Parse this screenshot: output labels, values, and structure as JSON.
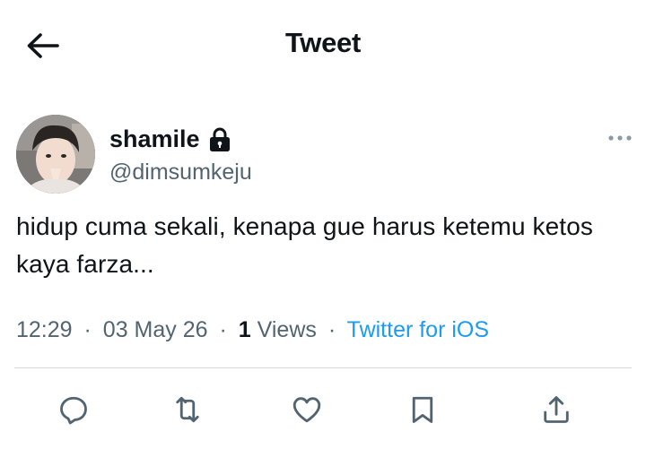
{
  "header": {
    "title": "Tweet"
  },
  "author": {
    "display_name": "shamile",
    "handle": "@dimsumkeju",
    "protected": true
  },
  "tweet": {
    "text": "hidup cuma sekali, kenapa gue harus ketemu ketos\nkaya farza..."
  },
  "meta": {
    "time": "12:29",
    "date": "03 May 26",
    "views_count": "1",
    "views_label": "Views",
    "source": "Twitter for iOS",
    "separator": "·"
  },
  "icons": {
    "back": "arrow-left-icon",
    "lock": "lock-icon",
    "more": "more-dots-icon",
    "reply": "reply-icon",
    "retweet": "retweet-icon",
    "like": "heart-icon",
    "bookmark": "bookmark-icon",
    "share": "share-icon"
  },
  "colors": {
    "text": "#0f1419",
    "secondary": "#536471",
    "link": "#1d9bf0",
    "divider": "#cfd9de"
  }
}
